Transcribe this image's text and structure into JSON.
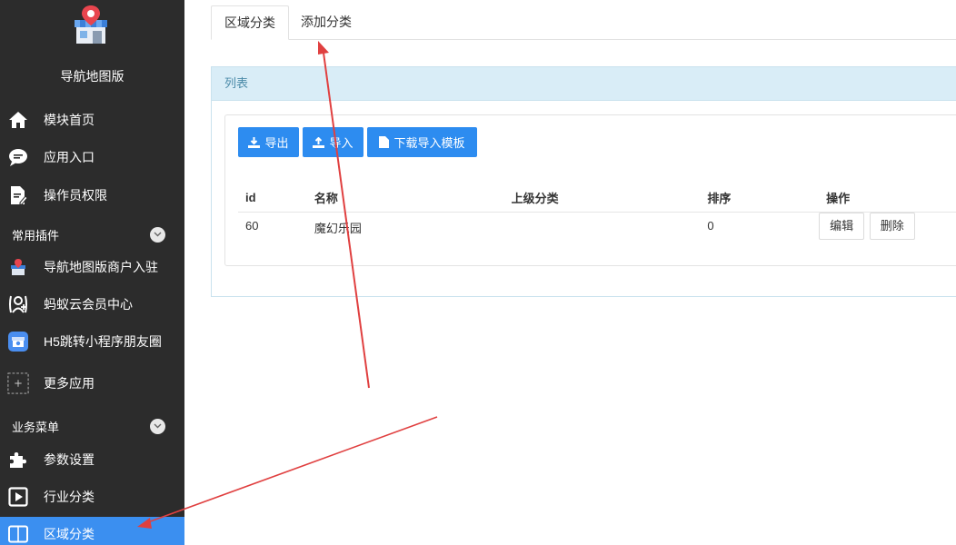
{
  "sidebar": {
    "app_name": "导航地图版",
    "main_items": [
      {
        "label": "模块首页",
        "icon": "home-icon"
      },
      {
        "label": "应用入口",
        "icon": "chat-bubble-icon"
      },
      {
        "label": "操作员权限",
        "icon": "document-edit-icon"
      }
    ],
    "plugins_group": {
      "title": "常用插件",
      "items": [
        {
          "label": "导航地图版商户入驻",
          "icon": "shop-map-icon"
        },
        {
          "label": "蚂蚁云会员中心",
          "icon": "member-center-icon"
        },
        {
          "label": "H5跳转小程序朋友圈",
          "icon": "miniprogram-icon"
        },
        {
          "label": "更多应用",
          "icon": "plus-icon"
        }
      ]
    },
    "business_group": {
      "title": "业务菜单",
      "items": [
        {
          "label": "参数设置",
          "icon": "puzzle-icon"
        },
        {
          "label": "行业分类",
          "icon": "play-icon"
        },
        {
          "label": "区域分类",
          "icon": "columns-icon",
          "active": true
        }
      ]
    }
  },
  "tabs": [
    {
      "label": "区域分类",
      "active": true
    },
    {
      "label": "添加分类",
      "active": false
    }
  ],
  "panel": {
    "title": "列表",
    "buttons": {
      "export": "导出",
      "import": "导入",
      "download_template": "下载导入模板"
    },
    "table": {
      "headers": {
        "id": "id",
        "name": "名称",
        "parent": "上级分类",
        "sort": "排序",
        "actions": "操作"
      },
      "rows": [
        {
          "id": "60",
          "name": "魔幻乐园",
          "parent": "",
          "sort": "0",
          "edit": "编辑",
          "delete": "删除"
        }
      ]
    }
  },
  "colors": {
    "sidebar_bg": "#2c2c2c",
    "active_item": "#3b8ff0",
    "primary_button": "#2d8cf0",
    "panel_head": "#d9edf7",
    "annotation_arrow": "#e04040"
  }
}
